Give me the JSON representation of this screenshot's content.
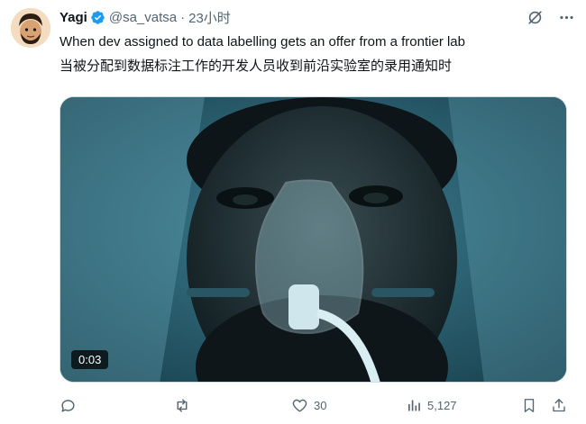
{
  "tweet": {
    "author_name": "Yagi",
    "handle": "@sa_vatsa",
    "separator": "·",
    "time": "23小时",
    "text_en": "When dev assigned to data labelling gets an offer from a frontier lab",
    "text_zh": "当被分配到数据标注工作的开发人员收到前沿实验室的录用通知时"
  },
  "media": {
    "duration": "0:03"
  },
  "actions": {
    "replies": "",
    "reposts": "",
    "likes": "30",
    "views": "5,127"
  },
  "colors": {
    "verified": "#1d9bf0",
    "secondary_text": "#536471",
    "text": "#0f1419"
  }
}
